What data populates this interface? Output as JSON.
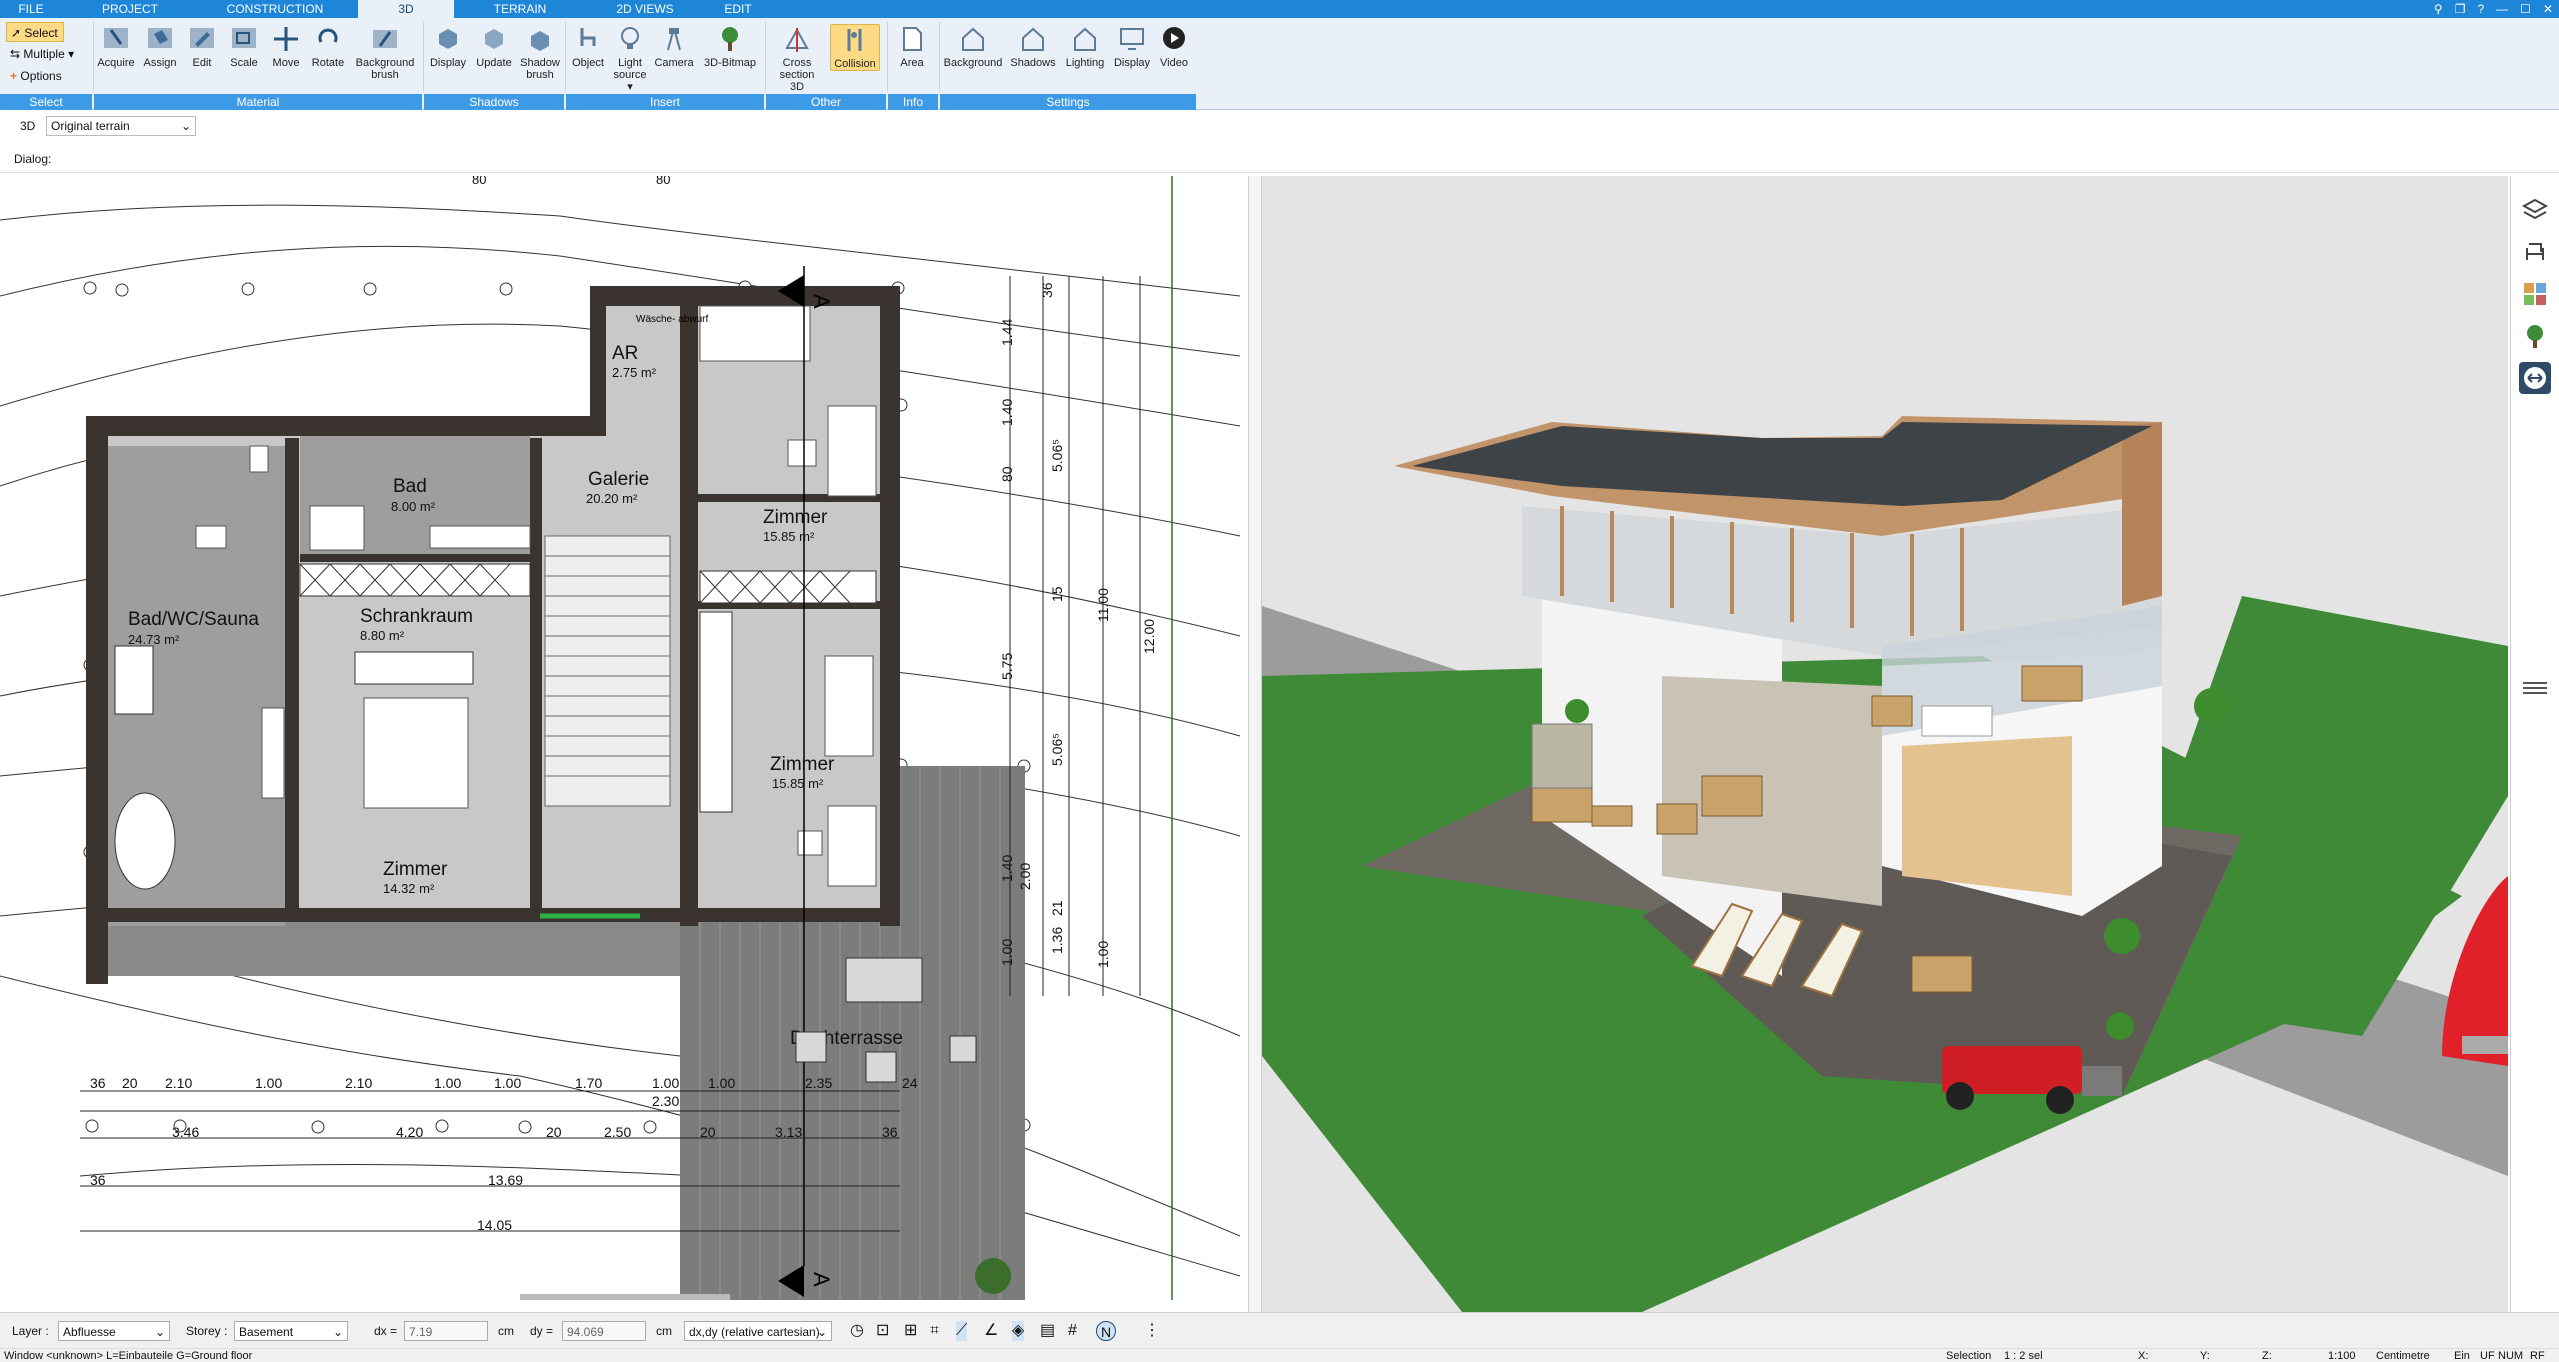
{
  "tabs": [
    "FILE",
    "PROJECT",
    "CONSTRUCTION",
    "3D",
    "TERRAIN",
    "2D VIEWS",
    "EDIT"
  ],
  "ribbon": {
    "select": {
      "select": "Select",
      "multiple": "Multiple",
      "options": "Options",
      "label": "Select"
    },
    "material": {
      "label": "Material",
      "tools": [
        "Acquire",
        "Assign",
        "Edit",
        "Scale",
        "Move",
        "Rotate",
        "Background brush"
      ]
    },
    "shadows": {
      "label": "Shadows",
      "tools": [
        "Display",
        "Update",
        "Shadow brush"
      ]
    },
    "insert": {
      "label": "Insert",
      "tools": [
        "Object",
        "Light source",
        "Camera",
        "3D-Bitmap"
      ]
    },
    "other": {
      "label": "Other",
      "tools": [
        "Cross section 3D",
        "Collision"
      ]
    },
    "info": {
      "label": "Info",
      "tools": [
        "Area"
      ]
    },
    "settings": {
      "label": "Settings",
      "tools": [
        "Background",
        "Shadows",
        "Lighting",
        "Display",
        "Video"
      ]
    }
  },
  "context": {
    "mode": "3D",
    "terrain": "Original terrain"
  },
  "dialog": {
    "label": "Dialog:"
  },
  "plan": {
    "rooms": [
      {
        "name": "AR",
        "area": "2.75 m²"
      },
      {
        "name": "Bad",
        "area": "8.00 m²"
      },
      {
        "name": "Galerie",
        "area": "20.20 m²"
      },
      {
        "name": "Zimmer",
        "area": "15.85 m²"
      },
      {
        "name": "Bad/WC/Sauna",
        "area": "24.73 m²"
      },
      {
        "name": "Schrankraum",
        "area": "8.80 m²"
      },
      {
        "name": "Zimmer",
        "area": "15.85 m²"
      },
      {
        "name": "Zimmer",
        "area": "14.32 m²"
      },
      {
        "name": "Dachterrasse",
        "area": ""
      }
    ],
    "note": "Wäsche-\nabwurf",
    "section_marks": [
      "A",
      "A"
    ],
    "top_dims": [
      "80",
      "80"
    ],
    "dims_row1": [
      "36",
      "20",
      "2.10",
      "1.00",
      "2.10",
      "1.00",
      "1.00",
      "1.70",
      "1.00",
      "1.00",
      "2.35",
      "24"
    ],
    "dims_row1b": [
      "2.30"
    ],
    "dims_row2": [
      "3.46",
      "4.20",
      "20",
      "2.50",
      "20",
      "3.13",
      "36"
    ],
    "dims_row3": [
      "36",
      "13.69"
    ],
    "dims_row4": [
      "14.05"
    ],
    "vdims_a": [
      "36",
      "1.44",
      "1.40",
      "80",
      "15",
      "5.75",
      "1.40",
      "21",
      "1.00",
      "1.36"
    ],
    "vdims_b": [
      "5.06⁵",
      "5.06⁵",
      "2.00",
      "11.00",
      "1.00",
      "12.00"
    ]
  },
  "status": {
    "layer_label": "Layer :",
    "layer_value": "Abfluesse",
    "storey_label": "Storey :",
    "storey_value": "Basement",
    "dx_label": "dx =",
    "dx_value": "7.19",
    "dx_unit": "cm",
    "dy_label": "dy =",
    "dy_value": "94.069",
    "dy_unit": "cm",
    "coord_mode": "dx,dy (relative cartesian)"
  },
  "info": {
    "window": "Window <unknown> L=Einbauteile G=Ground floor",
    "selection": "Selection",
    "sel_count": "1 : 2 sel",
    "x": "X:",
    "y": "Y:",
    "z": "Z:",
    "scale": "1:100",
    "unit": "Centimetre",
    "ein": "Ein",
    "uf": "UF",
    "num": "NUM",
    "rf": "RF"
  },
  "colors": {
    "titlebar": "#1d86d8",
    "ribbon": "#e9f0f8",
    "group_label": "#3d9ae6",
    "active_tool": "#fddb86",
    "lawn": "#3f8a36",
    "deck": "#6f6964",
    "roof": "#3e4347",
    "cladding": "#c2946a"
  }
}
